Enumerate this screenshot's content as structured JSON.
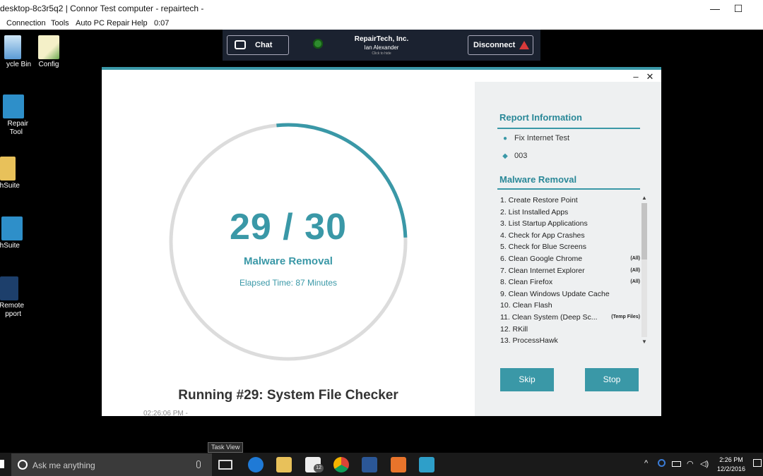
{
  "remote_window": {
    "title": "desktop-8c3r5q2 | Connor Test computer - repairtech -",
    "minimize_glyph": "—",
    "maximize_glyph": "☐",
    "menu": [
      "Connection",
      "Tools",
      "Auto PC Repair",
      "Help",
      "0:07"
    ]
  },
  "desktop_icons": [
    {
      "label": "ycle Bin",
      "label2": "",
      "icon": "recycle-bin-icon"
    },
    {
      "label": "Config",
      "label2": "",
      "icon": "config-file-icon"
    },
    {
      "label": "Repair",
      "label2": "Tool",
      "icon": "repair-tool-icon"
    },
    {
      "label": "hSuite",
      "label2": "",
      "icon": "folder-icon"
    },
    {
      "label": "hSuite",
      "label2": "",
      "icon": "techsuite-icon"
    },
    {
      "label": "Remote",
      "label2": "pport",
      "icon": "remote-support-icon"
    }
  ],
  "connection_bar": {
    "chat_label": "Chat",
    "company": "RepairTech, Inc.",
    "technician": "Ian Alexander",
    "hint": "Click to hide",
    "disconnect_label": "Disconnect",
    "status_color": "#2e8b2e"
  },
  "app": {
    "minimize_glyph": "–",
    "close_glyph": "✕",
    "progress": {
      "current": 29,
      "total": 30,
      "count_text": "29 / 30",
      "label": "Malware Removal",
      "elapsed": "Elapsed Time: 87 Minutes"
    },
    "running": "Running #29: System File Checker",
    "timestamp": "02:26:06 PM -",
    "report": {
      "title": "Report Information",
      "report_name": "Fix Internet Test",
      "ticket": "003"
    },
    "steps_title": "Malware Removal",
    "steps": [
      {
        "label": "1. Create Restore Point",
        "tag": ""
      },
      {
        "label": "2. List Installed Apps",
        "tag": ""
      },
      {
        "label": "3. List Startup Applications",
        "tag": ""
      },
      {
        "label": "4. Check for App Crashes",
        "tag": ""
      },
      {
        "label": "5. Check for Blue Screens",
        "tag": ""
      },
      {
        "label": "6. Clean Google Chrome",
        "tag": "(All)"
      },
      {
        "label": "7. Clean Internet Explorer",
        "tag": "(All)"
      },
      {
        "label": "8. Clean Firefox",
        "tag": "(All)"
      },
      {
        "label": "9. Clean Windows Update Cache",
        "tag": ""
      },
      {
        "label": "10. Clean Flash",
        "tag": ""
      },
      {
        "label": "11. Clean System (Deep Sc...",
        "tag": "(Temp Files)"
      },
      {
        "label": "12. RKill",
        "tag": ""
      },
      {
        "label": "13. ProcessHawk",
        "tag": ""
      }
    ],
    "skip_label": "Skip",
    "stop_label": "Stop",
    "accent_color": "#3a98a7"
  },
  "taskbar": {
    "search_placeholder": "Ask me anything",
    "task_view_tooltip": "Task View",
    "mail_badge": "12",
    "time": "2:26 PM",
    "date": "12/2/2016",
    "apps": [
      "task-view-icon",
      "edge-icon",
      "file-explorer-icon",
      "mail-icon",
      "chrome-icon",
      "powershell-icon",
      "office-icon",
      "repairtech-icon"
    ]
  }
}
